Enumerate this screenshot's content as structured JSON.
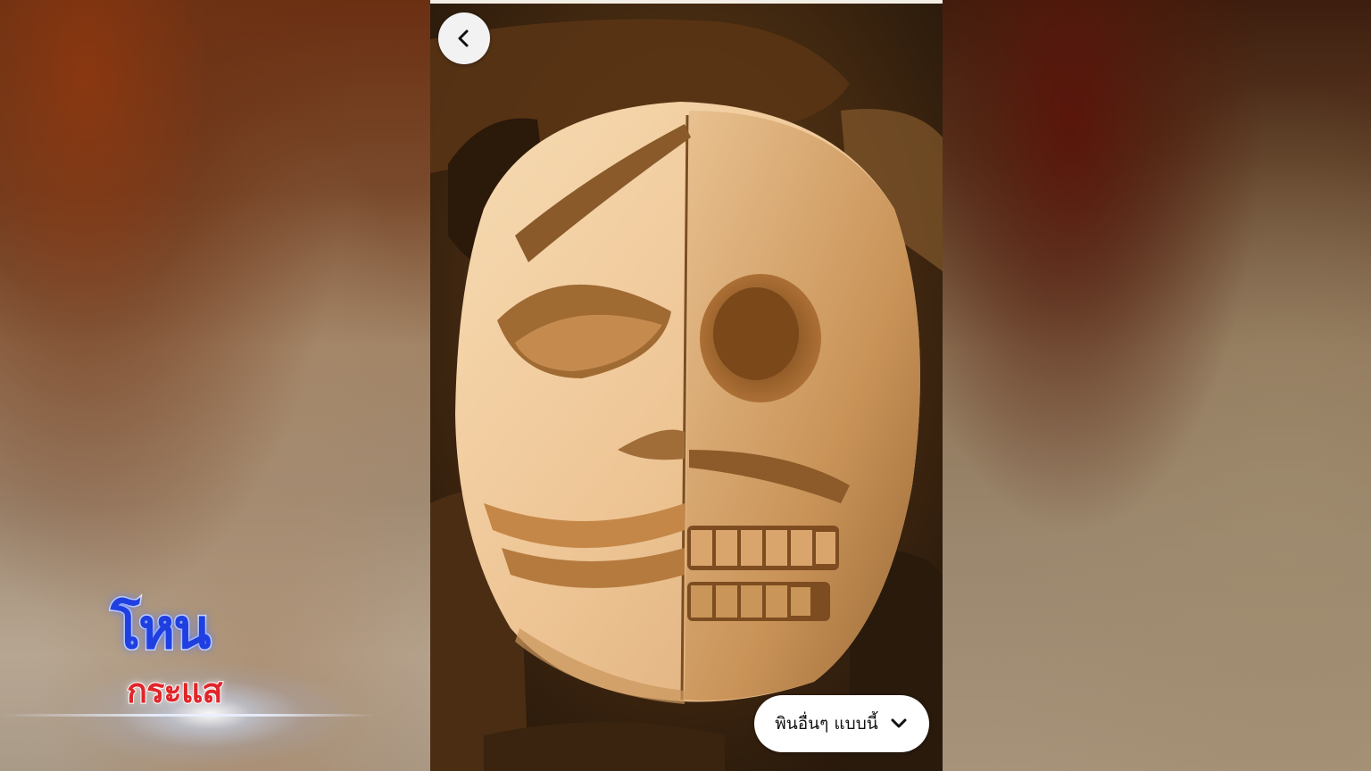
{
  "screen": {
    "back_button": {
      "icon": "chevron-left-icon"
    },
    "more_pins_button": {
      "label": "พินอื่นๆ แบบนี้",
      "icon": "chevron-down-icon"
    },
    "photo": {
      "subject": "carved-wooden-mask"
    }
  },
  "logo": {
    "line1": "โหน",
    "line2": "กระแส",
    "colors": {
      "line1": "#1f3fe0",
      "line2": "#e0262b"
    }
  }
}
